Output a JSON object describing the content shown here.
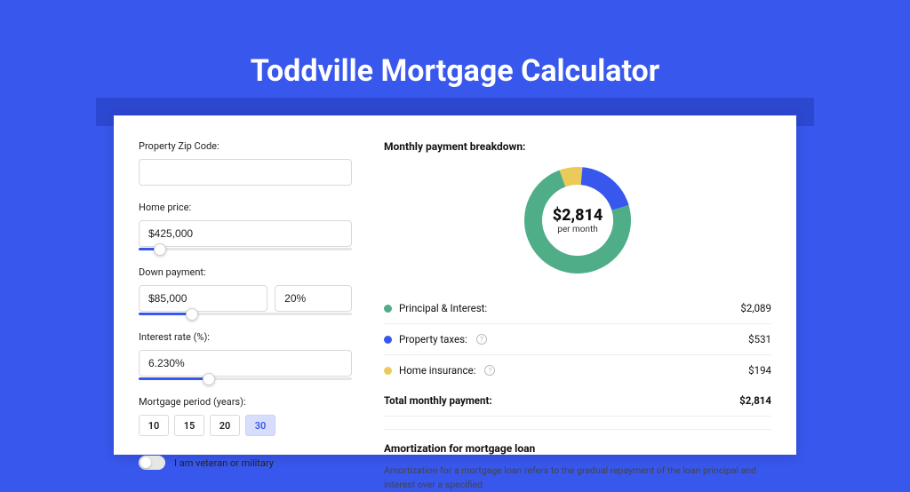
{
  "page": {
    "title": "Toddville Mortgage Calculator"
  },
  "form": {
    "zip": {
      "label": "Property Zip Code:",
      "value": ""
    },
    "price": {
      "label": "Home price:",
      "value": "$425,000",
      "slider_pct": 10
    },
    "down": {
      "label": "Down payment:",
      "amount": "$85,000",
      "percent": "20%",
      "slider_pct": 25
    },
    "rate": {
      "label": "Interest rate (%):",
      "value": "6.230%",
      "slider_pct": 33
    },
    "period": {
      "label": "Mortgage period (years):",
      "options": [
        "10",
        "15",
        "20",
        "30"
      ],
      "selected": "30"
    },
    "veteran": {
      "label": "I am veteran or military"
    }
  },
  "breakdown": {
    "heading": "Monthly payment breakdown:",
    "center_value": "$2,814",
    "center_caption": "per month",
    "items": [
      {
        "label": "Principal & Interest:",
        "value": "$2,089",
        "color": "#4fae87",
        "pct": 74,
        "info": false
      },
      {
        "label": "Property taxes:",
        "value": "$531",
        "color": "#3857ec",
        "pct": 19,
        "info": true
      },
      {
        "label": "Home insurance:",
        "value": "$194",
        "color": "#eacb5a",
        "pct": 7,
        "info": true
      }
    ],
    "total_label": "Total monthly payment:",
    "total_value": "$2,814"
  },
  "amortization": {
    "title": "Amortization for mortgage loan",
    "text": "Amortization for a mortgage loan refers to the gradual repayment of the loan principal and interest over a specified"
  },
  "chart_data": {
    "type": "pie",
    "title": "Monthly payment breakdown",
    "series": [
      {
        "name": "Principal & Interest",
        "value": 2089,
        "color": "#4fae87"
      },
      {
        "name": "Property taxes",
        "value": 531,
        "color": "#3857ec"
      },
      {
        "name": "Home insurance",
        "value": 194,
        "color": "#eacb5a"
      }
    ],
    "total": 2814,
    "center_label": "$2,814 per month"
  }
}
